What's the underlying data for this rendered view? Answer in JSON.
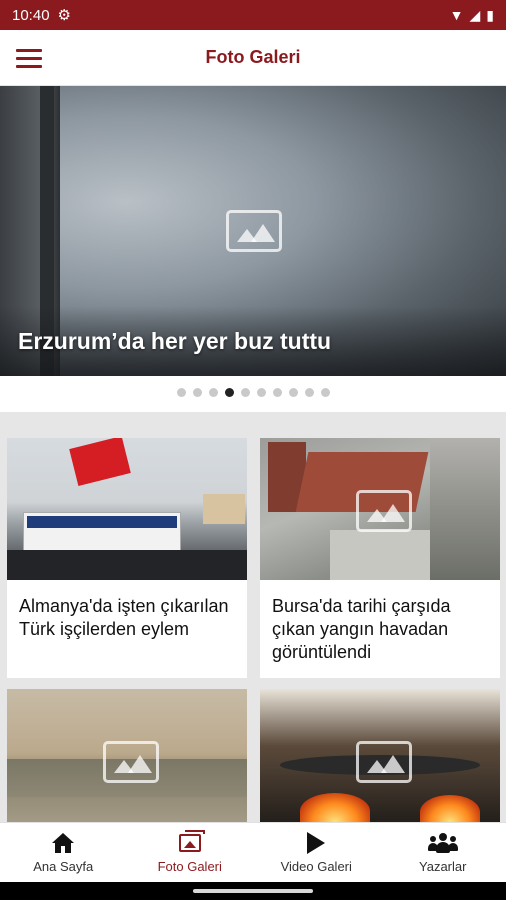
{
  "status_bar": {
    "time": "10:40"
  },
  "app_bar": {
    "title": "Foto Galeri"
  },
  "hero": {
    "title": "Erzurum’da her yer buz tuttu"
  },
  "carousel": {
    "total": 10,
    "active_index": 3
  },
  "cards": [
    {
      "title": "Almanya'da işten çıkarılan Türk işçilerden eylem"
    },
    {
      "title": "Bursa'da tarihi çarşıda çıkan yangın havadan görüntülendi"
    },
    {
      "title": ""
    },
    {
      "title": ""
    }
  ],
  "bottom_nav": {
    "items": [
      {
        "label": "Ana Sayfa",
        "icon": "home-icon",
        "active": false
      },
      {
        "label": "Foto Galeri",
        "icon": "photo-gallery-icon",
        "active": true
      },
      {
        "label": "Video Galeri",
        "icon": "play-icon",
        "active": false
      },
      {
        "label": "Yazarlar",
        "icon": "users-icon",
        "active": false
      }
    ]
  },
  "colors": {
    "brand": "#8b1a1f",
    "active_dot": "#222222",
    "inactive_dot": "#c9c9c9"
  }
}
